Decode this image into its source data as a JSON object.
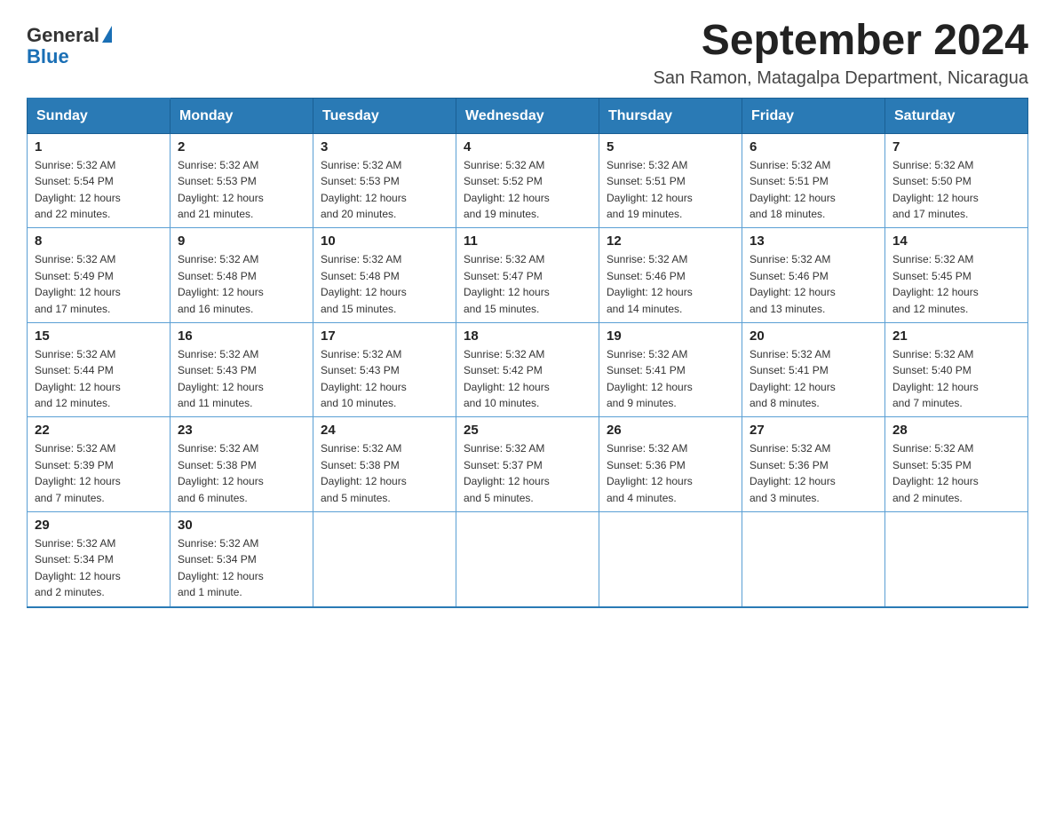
{
  "header": {
    "logo_line1": "General",
    "logo_line2": "Blue",
    "month_title": "September 2024",
    "subtitle": "San Ramon, Matagalpa Department, Nicaragua"
  },
  "days_of_week": [
    "Sunday",
    "Monday",
    "Tuesday",
    "Wednesday",
    "Thursday",
    "Friday",
    "Saturday"
  ],
  "weeks": [
    [
      {
        "day": "1",
        "sunrise": "5:32 AM",
        "sunset": "5:54 PM",
        "daylight": "12 hours and 22 minutes."
      },
      {
        "day": "2",
        "sunrise": "5:32 AM",
        "sunset": "5:53 PM",
        "daylight": "12 hours and 21 minutes."
      },
      {
        "day": "3",
        "sunrise": "5:32 AM",
        "sunset": "5:53 PM",
        "daylight": "12 hours and 20 minutes."
      },
      {
        "day": "4",
        "sunrise": "5:32 AM",
        "sunset": "5:52 PM",
        "daylight": "12 hours and 19 minutes."
      },
      {
        "day": "5",
        "sunrise": "5:32 AM",
        "sunset": "5:51 PM",
        "daylight": "12 hours and 19 minutes."
      },
      {
        "day": "6",
        "sunrise": "5:32 AM",
        "sunset": "5:51 PM",
        "daylight": "12 hours and 18 minutes."
      },
      {
        "day": "7",
        "sunrise": "5:32 AM",
        "sunset": "5:50 PM",
        "daylight": "12 hours and 17 minutes."
      }
    ],
    [
      {
        "day": "8",
        "sunrise": "5:32 AM",
        "sunset": "5:49 PM",
        "daylight": "12 hours and 17 minutes."
      },
      {
        "day": "9",
        "sunrise": "5:32 AM",
        "sunset": "5:48 PM",
        "daylight": "12 hours and 16 minutes."
      },
      {
        "day": "10",
        "sunrise": "5:32 AM",
        "sunset": "5:48 PM",
        "daylight": "12 hours and 15 minutes."
      },
      {
        "day": "11",
        "sunrise": "5:32 AM",
        "sunset": "5:47 PM",
        "daylight": "12 hours and 15 minutes."
      },
      {
        "day": "12",
        "sunrise": "5:32 AM",
        "sunset": "5:46 PM",
        "daylight": "12 hours and 14 minutes."
      },
      {
        "day": "13",
        "sunrise": "5:32 AM",
        "sunset": "5:46 PM",
        "daylight": "12 hours and 13 minutes."
      },
      {
        "day": "14",
        "sunrise": "5:32 AM",
        "sunset": "5:45 PM",
        "daylight": "12 hours and 12 minutes."
      }
    ],
    [
      {
        "day": "15",
        "sunrise": "5:32 AM",
        "sunset": "5:44 PM",
        "daylight": "12 hours and 12 minutes."
      },
      {
        "day": "16",
        "sunrise": "5:32 AM",
        "sunset": "5:43 PM",
        "daylight": "12 hours and 11 minutes."
      },
      {
        "day": "17",
        "sunrise": "5:32 AM",
        "sunset": "5:43 PM",
        "daylight": "12 hours and 10 minutes."
      },
      {
        "day": "18",
        "sunrise": "5:32 AM",
        "sunset": "5:42 PM",
        "daylight": "12 hours and 10 minutes."
      },
      {
        "day": "19",
        "sunrise": "5:32 AM",
        "sunset": "5:41 PM",
        "daylight": "12 hours and 9 minutes."
      },
      {
        "day": "20",
        "sunrise": "5:32 AM",
        "sunset": "5:41 PM",
        "daylight": "12 hours and 8 minutes."
      },
      {
        "day": "21",
        "sunrise": "5:32 AM",
        "sunset": "5:40 PM",
        "daylight": "12 hours and 7 minutes."
      }
    ],
    [
      {
        "day": "22",
        "sunrise": "5:32 AM",
        "sunset": "5:39 PM",
        "daylight": "12 hours and 7 minutes."
      },
      {
        "day": "23",
        "sunrise": "5:32 AM",
        "sunset": "5:38 PM",
        "daylight": "12 hours and 6 minutes."
      },
      {
        "day": "24",
        "sunrise": "5:32 AM",
        "sunset": "5:38 PM",
        "daylight": "12 hours and 5 minutes."
      },
      {
        "day": "25",
        "sunrise": "5:32 AM",
        "sunset": "5:37 PM",
        "daylight": "12 hours and 5 minutes."
      },
      {
        "day": "26",
        "sunrise": "5:32 AM",
        "sunset": "5:36 PM",
        "daylight": "12 hours and 4 minutes."
      },
      {
        "day": "27",
        "sunrise": "5:32 AM",
        "sunset": "5:36 PM",
        "daylight": "12 hours and 3 minutes."
      },
      {
        "day": "28",
        "sunrise": "5:32 AM",
        "sunset": "5:35 PM",
        "daylight": "12 hours and 2 minutes."
      }
    ],
    [
      {
        "day": "29",
        "sunrise": "5:32 AM",
        "sunset": "5:34 PM",
        "daylight": "12 hours and 2 minutes."
      },
      {
        "day": "30",
        "sunrise": "5:32 AM",
        "sunset": "5:34 PM",
        "daylight": "12 hours and 1 minute."
      },
      null,
      null,
      null,
      null,
      null
    ]
  ],
  "labels": {
    "sunrise": "Sunrise:",
    "sunset": "Sunset:",
    "daylight": "Daylight:"
  }
}
